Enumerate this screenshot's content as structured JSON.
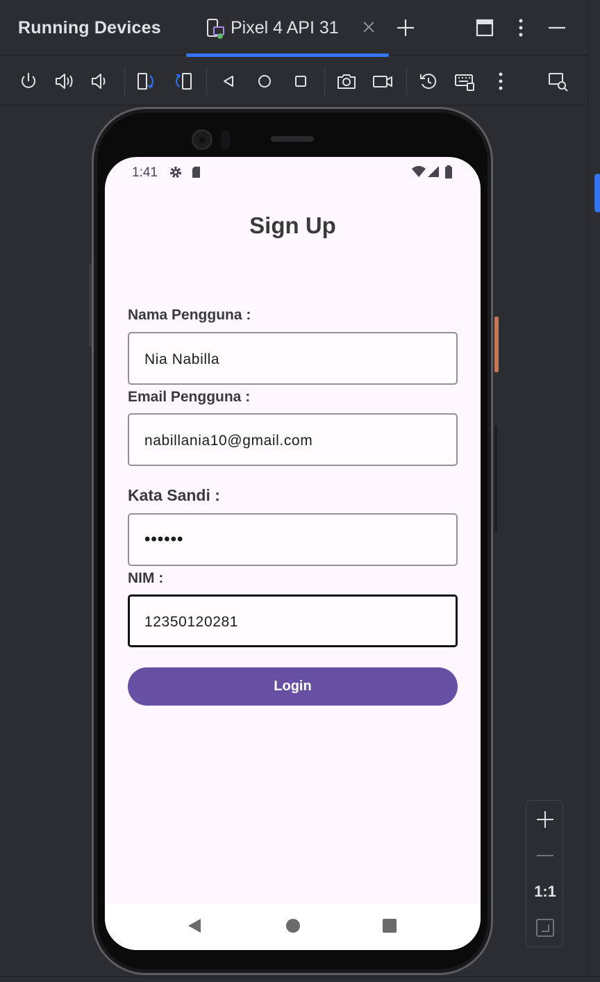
{
  "ide": {
    "panel_title": "Running Devices",
    "tab": {
      "label": "Pixel 4 API 31"
    },
    "toolbar_icons": [
      "power-icon",
      "volume-up-icon",
      "volume-down-icon",
      "rotate-left-icon",
      "rotate-right-icon",
      "back-icon",
      "home-icon",
      "overview-icon",
      "screenshot-icon",
      "screen-record-icon",
      "reset-icon",
      "keyboard-icon",
      "more-icon",
      "device-explorer-icon"
    ],
    "zoom": {
      "actual_size_label": "1:1"
    }
  },
  "device": {
    "status_bar": {
      "time": "1:41"
    },
    "screen": {
      "title": "Sign Up",
      "fields": {
        "username": {
          "label": "Nama Pengguna :",
          "value": "Nia Nabilla"
        },
        "email": {
          "label": "Email Pengguna :",
          "value": "nabillania10@gmail.com"
        },
        "password": {
          "label": "Kata Sandi :",
          "value": "••••••"
        },
        "nim": {
          "label": "NIM :",
          "value": "12350120281"
        }
      },
      "login_button": "Login"
    }
  },
  "colors": {
    "accent": "#3574f0",
    "button": "#6750a4",
    "screen_bg": "#fef7ff",
    "ide_bg": "#2b2d30"
  }
}
